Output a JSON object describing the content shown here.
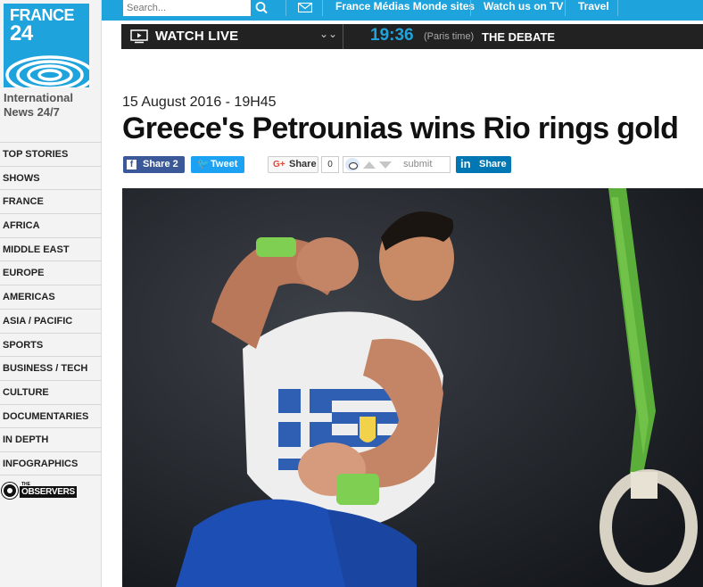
{
  "logo": {
    "line1": "FRANCE",
    "line2": "24"
  },
  "tagline": "International News 24/7",
  "nav": {
    "items": [
      "TOP STORIES",
      "SHOWS",
      "FRANCE",
      "AFRICA",
      "MIDDLE EAST",
      "EUROPE",
      "AMERICAS",
      "ASIA / PACIFIC",
      "SPORTS",
      "BUSINESS / TECH",
      "CULTURE",
      "DOCUMENTARIES",
      "IN DEPTH",
      "INFOGRAPHICS"
    ],
    "observers_the": "THE",
    "observers_word": "OBSERVERS"
  },
  "topbar": {
    "search_placeholder": "Search...",
    "links": [
      "France Médias Monde sites",
      "Watch us on TV",
      "Travel"
    ]
  },
  "live": {
    "watch_label": "WATCH LIVE",
    "time": "19:36",
    "paris_label": "(Paris time)",
    "show_name": "THE DEBATE"
  },
  "article": {
    "date": "15 August 2016 - 19H45",
    "headline": "Greece's Petrounias wins Rio rings gold"
  },
  "share": {
    "facebook_label": "Share",
    "facebook_count": "2",
    "twitter_label": "Tweet",
    "google_icon": "G+",
    "google_label": "Share",
    "google_count": "0",
    "reddit_label": "submit",
    "linkedin_icon": "in",
    "linkedin_label": "Share"
  },
  "colors": {
    "brand_blue": "#1fa3dc",
    "facebook": "#3b5998",
    "twitter": "#1da1f2",
    "linkedin": "#0077b5"
  },
  "icons": [
    "search-icon",
    "mail-icon",
    "tv-icon",
    "chevron-down-icon",
    "facebook-icon",
    "twitter-icon",
    "google-plus-icon",
    "reddit-icon",
    "linkedin-icon"
  ]
}
